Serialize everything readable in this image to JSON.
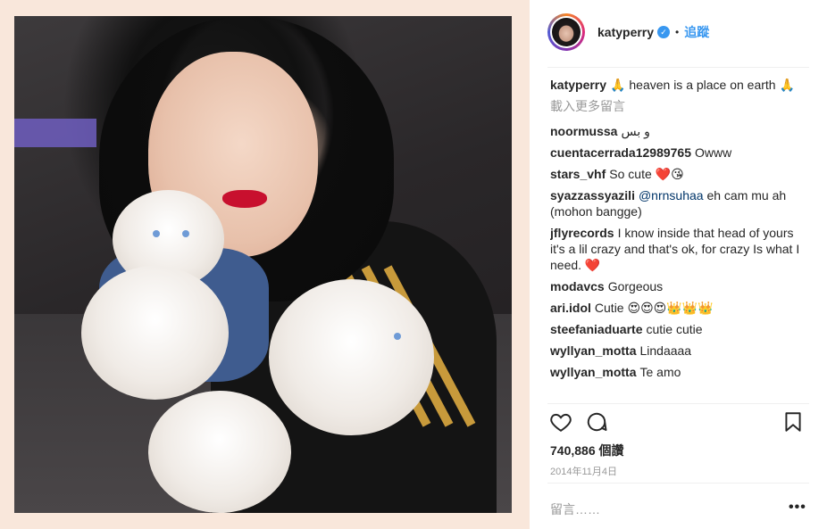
{
  "post": {
    "username": "katyperry",
    "verified_mark": "✓",
    "dot": "•",
    "follow_label": "追蹤",
    "likes": "740,886 個讚",
    "date": "2014年11月4日",
    "comment_placeholder": "留言……",
    "more_label": "•••"
  },
  "caption": {
    "user": "katyperry",
    "text": "🙏 heaven is a place on earth 🙏"
  },
  "load_more": "載入更多留言",
  "comments": [
    {
      "user": "noormussa",
      "text": "و بس"
    },
    {
      "user": "cuentacerrada12989765",
      "text": "Owww"
    },
    {
      "user": "stars_vhf",
      "text": "So cute ❤️😘"
    },
    {
      "user": "syazzassyazili",
      "mention": "@nrnsuhaa",
      "text": " eh cam mu ah (mohon bangge)"
    },
    {
      "user": "jflyrecords",
      "text": "I know inside that head of yours it's a lil crazy and that's ok, for crazy Is what I need. ❤️"
    },
    {
      "user": "modavcs",
      "text": "Gorgeous"
    },
    {
      "user": "ari.idol",
      "text": "Cutie 😍😍😍👑👑👑"
    },
    {
      "user": "steefaniaduarte",
      "text": "cutie cutie"
    },
    {
      "user": "wyllyan_motta",
      "text": "Lindaaaa"
    },
    {
      "user": "wyllyan_motta",
      "text": "Te amo"
    }
  ],
  "icons": {
    "like": "heart-icon",
    "comment": "comment-bubble-icon",
    "save": "bookmark-icon",
    "verified": "verified-badge-icon"
  },
  "colors": {
    "accent": "#3897f0",
    "photo_bg": "#f9e7db",
    "text": "#262626",
    "muted": "#999999"
  }
}
